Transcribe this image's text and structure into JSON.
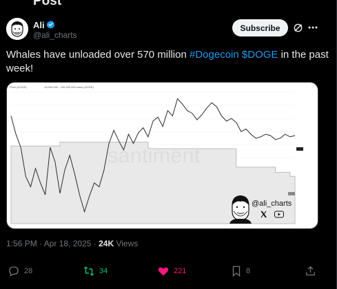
{
  "header": {
    "title": "Post"
  },
  "author": {
    "name": "Ali",
    "handle": "@ali_charts"
  },
  "subscribe_label": "Subscribe",
  "tweet": {
    "text_before": "Whales have unloaded over 570 million ",
    "hashtag": "#Dogecoin",
    "space": " ",
    "cashtag": "$DOGE",
    "text_after": " in the past week!"
  },
  "media": {
    "watermark": "santiment",
    "legend_price": "Price (DOGE)",
    "legend_series": "10,000,000 - 100,000,000 coins (DOGE)",
    "overlay_handle": "@ali_charts"
  },
  "meta": {
    "time": "1:56 PM",
    "separator": " · ",
    "date": "Apr 18, 2025",
    "dot": " · ",
    "views_count": "24K",
    "views_label": " Views"
  },
  "actions": {
    "replies": "28",
    "reposts": "34",
    "likes": "221",
    "bookmarks": "8"
  },
  "colors": {
    "accent": "#1d9bf0",
    "repost": "#00ba7c",
    "like": "#f91880",
    "muted": "#71767b"
  },
  "chart_data": {
    "type": "line",
    "series": [
      {
        "name": "Price (DOGE)",
        "values": [
          0.172,
          0.158,
          0.148,
          0.126,
          0.118,
          0.132,
          0.121,
          0.112,
          0.148,
          0.137,
          0.113,
          0.131,
          0.142,
          0.128,
          0.112,
          0.099,
          0.111,
          0.121,
          0.118,
          0.131,
          0.151,
          0.161,
          0.153,
          0.146,
          0.158,
          0.151,
          0.159,
          0.163,
          0.156,
          0.168,
          0.171,
          0.164,
          0.176,
          0.172,
          0.185,
          0.181,
          0.176,
          0.174,
          0.169,
          0.173,
          0.178,
          0.182,
          0.179,
          0.172,
          0.168,
          0.17,
          0.167,
          0.16,
          0.162,
          0.158,
          0.155,
          0.156,
          0.158,
          0.157,
          0.154,
          0.155,
          0.158,
          0.156,
          0.157
        ]
      },
      {
        "name": "10,000,000 - 100,000,000 coins (DOGE)",
        "values": [
          0.149,
          0.149,
          0.149,
          0.149,
          0.149,
          0.149,
          0.149,
          0.149,
          0.149,
          0.149,
          0.152,
          0.152,
          0.152,
          0.152,
          0.152,
          0.152,
          0.152,
          0.152,
          0.152,
          0.152,
          0.152,
          0.152,
          0.152,
          0.152,
          0.152,
          0.152,
          0.152,
          0.152,
          0.147,
          0.147,
          0.147,
          0.147,
          0.147,
          0.147,
          0.147,
          0.147,
          0.147,
          0.147,
          0.147,
          0.147,
          0.147,
          0.147,
          0.147,
          0.147,
          0.147,
          0.147,
          0.133,
          0.133,
          0.133,
          0.133,
          0.133,
          0.133,
          0.133,
          0.133,
          0.129,
          0.129,
          0.129,
          0.126,
          0.126
        ]
      }
    ],
    "ylim": [
      0.09,
      0.19
    ],
    "grid": true
  }
}
